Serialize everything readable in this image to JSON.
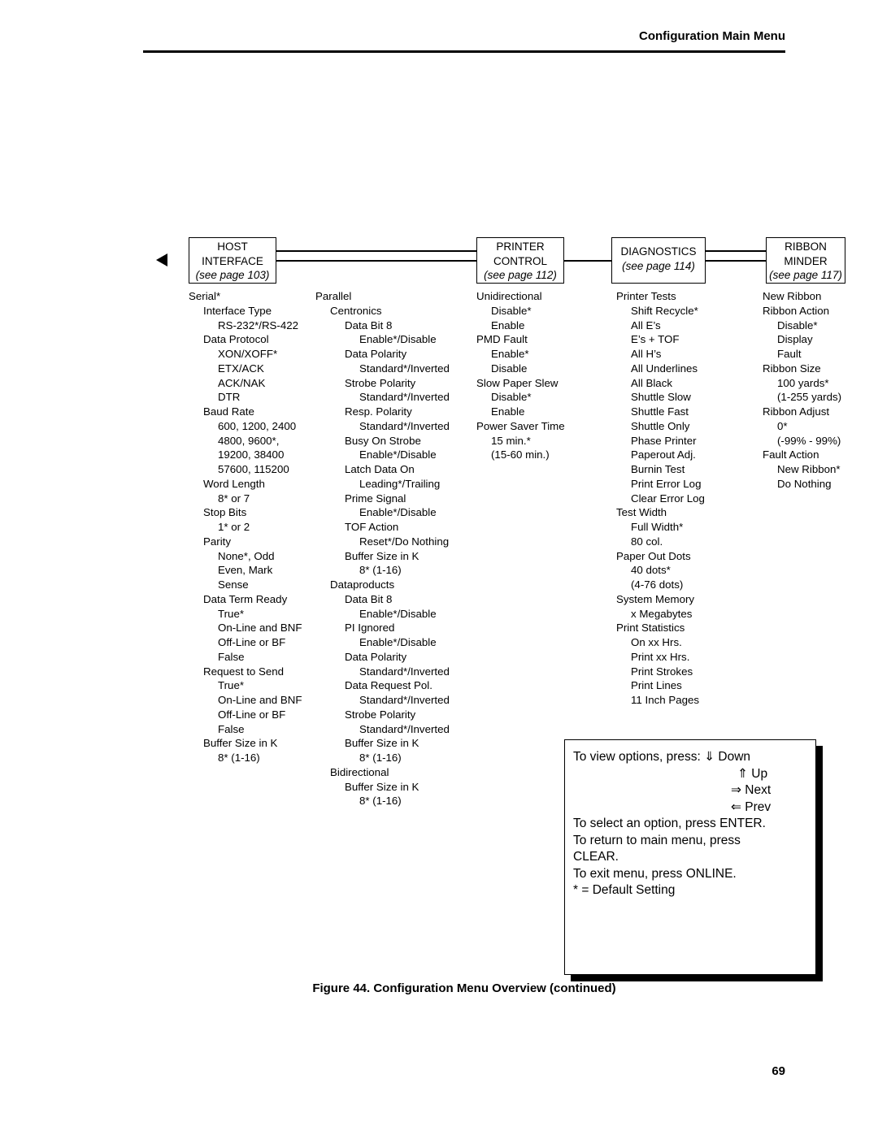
{
  "header": {
    "title": "Configuration Main Menu"
  },
  "boxes": [
    {
      "name": "host-interface",
      "line1": "HOST",
      "line2": "INTERFACE",
      "line3": "(see page 103)"
    },
    {
      "name": "printer-control",
      "line1": "PRINTER",
      "line2": "CONTROL",
      "line3": "(see page 112)"
    },
    {
      "name": "diagnostics",
      "line1": "DIAGNOSTICS",
      "line2": "(see page 114)",
      "line3": ""
    },
    {
      "name": "ribbon-minder",
      "line1": "RIBBON",
      "line2": "MINDER",
      "line3": "(see page 117)"
    }
  ],
  "columns": {
    "host_serial": [
      {
        "text": "Serial*",
        "indent": 0
      },
      {
        "text": "Interface Type",
        "indent": 1
      },
      {
        "text": "RS-232*/RS-422",
        "indent": 2
      },
      {
        "text": "Data Protocol",
        "indent": 1
      },
      {
        "text": "XON/XOFF*",
        "indent": 2
      },
      {
        "text": "ETX/ACK",
        "indent": 2
      },
      {
        "text": "ACK/NAK",
        "indent": 2
      },
      {
        "text": "DTR",
        "indent": 2
      },
      {
        "text": "Baud Rate",
        "indent": 1
      },
      {
        "text": "600, 1200, 2400",
        "indent": 2
      },
      {
        "text": "4800, 9600*,",
        "indent": 2
      },
      {
        "text": "19200, 38400",
        "indent": 2
      },
      {
        "text": "57600, 115200",
        "indent": 2
      },
      {
        "text": "Word Length",
        "indent": 1
      },
      {
        "text": "8* or 7",
        "indent": 2
      },
      {
        "text": "Stop Bits",
        "indent": 1
      },
      {
        "text": "1* or 2",
        "indent": 2
      },
      {
        "text": "Parity",
        "indent": 1
      },
      {
        "text": "None*, Odd",
        "indent": 2
      },
      {
        "text": "Even, Mark",
        "indent": 2
      },
      {
        "text": "Sense",
        "indent": 2
      },
      {
        "text": "Data Term Ready",
        "indent": 1
      },
      {
        "text": "True*",
        "indent": 2
      },
      {
        "text": "On-Line and BNF",
        "indent": 2
      },
      {
        "text": "Off-Line or BF",
        "indent": 2
      },
      {
        "text": "False",
        "indent": 2
      },
      {
        "text": "Request to Send",
        "indent": 1
      },
      {
        "text": "True*",
        "indent": 2
      },
      {
        "text": "On-Line and BNF",
        "indent": 2
      },
      {
        "text": "Off-Line or BF",
        "indent": 2
      },
      {
        "text": "False",
        "indent": 2
      },
      {
        "text": "Buffer Size in K",
        "indent": 1
      },
      {
        "text": "8* (1-16)",
        "indent": 2
      }
    ],
    "host_parallel": [
      {
        "text": "Parallel",
        "indent": 0
      },
      {
        "text": "Centronics",
        "indent": 1
      },
      {
        "text": "Data Bit 8",
        "indent": 2
      },
      {
        "text": "Enable*/Disable",
        "indent": 3
      },
      {
        "text": "Data Polarity",
        "indent": 2
      },
      {
        "text": "Standard*/Inverted",
        "indent": 3
      },
      {
        "text": "Strobe Polarity",
        "indent": 2
      },
      {
        "text": "Standard*/Inverted",
        "indent": 3
      },
      {
        "text": "Resp. Polarity",
        "indent": 2
      },
      {
        "text": "Standard*/Inverted",
        "indent": 3
      },
      {
        "text": "Busy On Strobe",
        "indent": 2
      },
      {
        "text": "Enable*/Disable",
        "indent": 3
      },
      {
        "text": "Latch Data On",
        "indent": 2
      },
      {
        "text": "Leading*/Trailing",
        "indent": 3
      },
      {
        "text": "Prime Signal",
        "indent": 2
      },
      {
        "text": "Enable*/Disable",
        "indent": 3
      },
      {
        "text": "TOF Action",
        "indent": 2
      },
      {
        "text": "Reset*/Do Nothing",
        "indent": 3
      },
      {
        "text": "Buffer Size in K",
        "indent": 2
      },
      {
        "text": "8* (1-16)",
        "indent": 3
      },
      {
        "text": "Dataproducts",
        "indent": 1
      },
      {
        "text": "Data Bit 8",
        "indent": 2
      },
      {
        "text": "Enable*/Disable",
        "indent": 3
      },
      {
        "text": "PI Ignored",
        "indent": 2
      },
      {
        "text": "Enable*/Disable",
        "indent": 3
      },
      {
        "text": "Data Polarity",
        "indent": 2
      },
      {
        "text": "Standard*/Inverted",
        "indent": 3
      },
      {
        "text": "Data Request Pol.",
        "indent": 2
      },
      {
        "text": "Standard*/Inverted",
        "indent": 3
      },
      {
        "text": "Strobe Polarity",
        "indent": 2
      },
      {
        "text": "Standard*/Inverted",
        "indent": 3
      },
      {
        "text": "Buffer Size in K",
        "indent": 2
      },
      {
        "text": "8* (1-16)",
        "indent": 3
      },
      {
        "text": "Bidirectional",
        "indent": 1
      },
      {
        "text": "Buffer Size in K",
        "indent": 2
      },
      {
        "text": "8* (1-16)",
        "indent": 3
      }
    ],
    "printer_control": [
      {
        "text": "Unidirectional",
        "indent": 0
      },
      {
        "text": "Disable*",
        "indent": 1
      },
      {
        "text": "Enable",
        "indent": 1
      },
      {
        "text": "PMD Fault",
        "indent": 0
      },
      {
        "text": "Enable*",
        "indent": 1
      },
      {
        "text": "Disable",
        "indent": 1
      },
      {
        "text": "Slow Paper Slew",
        "indent": 0
      },
      {
        "text": "Disable*",
        "indent": 1
      },
      {
        "text": "Enable",
        "indent": 1
      },
      {
        "text": "Power Saver Time",
        "indent": 0
      },
      {
        "text": "15 min.*",
        "indent": 1
      },
      {
        "text": "(15-60 min.)",
        "indent": 1
      }
    ],
    "diagnostics": [
      {
        "text": "Printer Tests",
        "indent": 0
      },
      {
        "text": "Shift Recycle*",
        "indent": 1
      },
      {
        "text": "All E’s",
        "indent": 1
      },
      {
        "text": "E’s + TOF",
        "indent": 1
      },
      {
        "text": "All H’s",
        "indent": 1
      },
      {
        "text": "All Underlines",
        "indent": 1
      },
      {
        "text": "All Black",
        "indent": 1
      },
      {
        "text": "Shuttle Slow",
        "indent": 1
      },
      {
        "text": "Shuttle Fast",
        "indent": 1
      },
      {
        "text": "Shuttle Only",
        "indent": 1
      },
      {
        "text": "Phase Printer",
        "indent": 1
      },
      {
        "text": "Paperout Adj.",
        "indent": 1
      },
      {
        "text": "Burnin Test",
        "indent": 1
      },
      {
        "text": "Print Error Log",
        "indent": 1
      },
      {
        "text": "Clear Error Log",
        "indent": 1
      },
      {
        "text": "Test Width",
        "indent": 0
      },
      {
        "text": "Full Width*",
        "indent": 1
      },
      {
        "text": "80 col.",
        "indent": 1
      },
      {
        "text": "Paper Out Dots",
        "indent": 0
      },
      {
        "text": "40 dots*",
        "indent": 1
      },
      {
        "text": "(4-76 dots)",
        "indent": 1
      },
      {
        "text": "System Memory",
        "indent": 0
      },
      {
        "text": "x Megabytes",
        "indent": 1
      },
      {
        "text": "Print Statistics",
        "indent": 0
      },
      {
        "text": "On xx Hrs.",
        "indent": 1
      },
      {
        "text": "Print xx Hrs.",
        "indent": 1
      },
      {
        "text": "Print Strokes",
        "indent": 1
      },
      {
        "text": "Print Lines",
        "indent": 1
      },
      {
        "text": "11 Inch Pages",
        "indent": 1
      }
    ],
    "ribbon_minder": [
      {
        "text": "New Ribbon",
        "indent": 0
      },
      {
        "text": "Ribbon Action",
        "indent": 0
      },
      {
        "text": "Disable*",
        "indent": 1
      },
      {
        "text": "Display",
        "indent": 1
      },
      {
        "text": "Fault",
        "indent": 1
      },
      {
        "text": "Ribbon Size",
        "indent": 0
      },
      {
        "text": "100 yards*",
        "indent": 1
      },
      {
        "text": "(1-255 yards)",
        "indent": 1
      },
      {
        "text": "Ribbon Adjust",
        "indent": 0
      },
      {
        "text": "0*",
        "indent": 1
      },
      {
        "text": "(-99% - 99%)",
        "indent": 1
      },
      {
        "text": "Fault Action",
        "indent": 0
      },
      {
        "text": "New Ribbon*",
        "indent": 1
      },
      {
        "text": "Do Nothing",
        "indent": 1
      }
    ]
  },
  "instructions": {
    "line1": "To view options, press:",
    "line1b": "⇓ Down",
    "line2": "⇑ Up",
    "line3": "⇒ Next",
    "line4": "⇐ Prev",
    "line5": "To select an option, press ENTER.",
    "line6": "To return to main menu, press",
    "line7": "CLEAR.",
    "line8": "To exit menu, press ONLINE.",
    "line9": "* = Default Setting"
  },
  "caption": "Figure 44. Configuration Menu Overview (continued)",
  "page_number": "69"
}
